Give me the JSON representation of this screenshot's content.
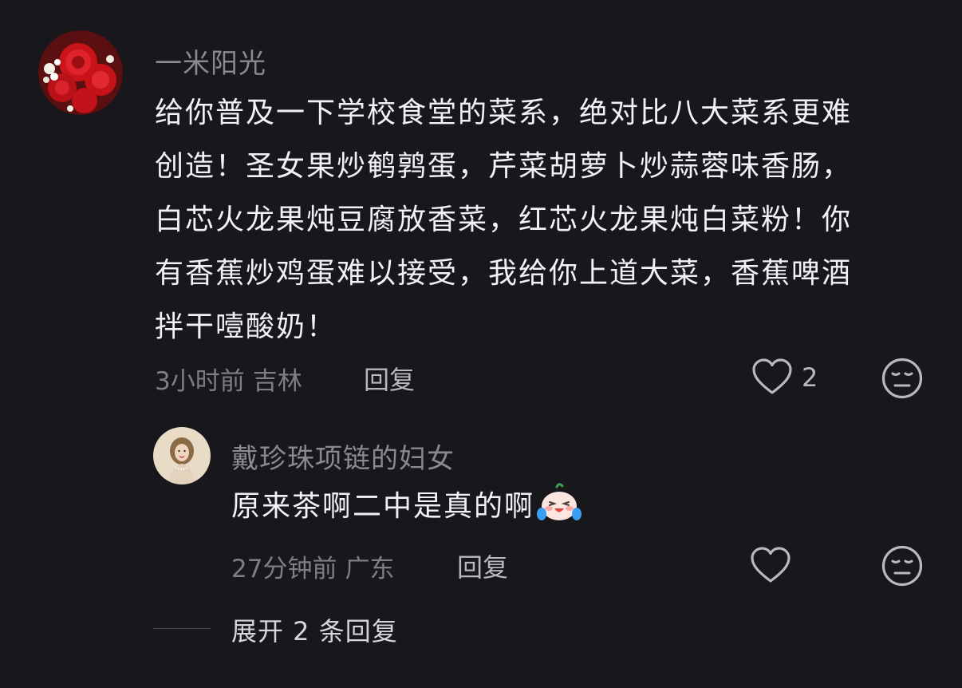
{
  "comment": {
    "username": "一米阳光",
    "text_lines": [
      "给你普及一下学校食堂的菜系，绝对比八大菜系更难",
      "创造！圣女果炒鹌鹑蛋，芹菜胡萝卜炒蒜蓉味香肠，",
      "白芯火龙果炖豆腐放香菜，红芯火龙果炖白菜粉！你",
      "有香蕉炒鸡蛋难以接受，我给你上道大菜，香蕉啤酒",
      "拌干噎酸奶！"
    ],
    "time": "3小时前",
    "location": "吉林",
    "reply_label": "回复",
    "like_count": "2"
  },
  "reply": {
    "username": "戴珍珠项链的妇女",
    "text": "原来茶啊二中是真的啊",
    "emoji": "crying-laughing-emoji",
    "time": "27分钟前",
    "location": "广东",
    "reply_label": "回复"
  },
  "expand": {
    "label": "展开 2 条回复"
  },
  "colors": {
    "background": "#18171c",
    "text": "#f2f2f4",
    "muted": "#7f7e84"
  }
}
